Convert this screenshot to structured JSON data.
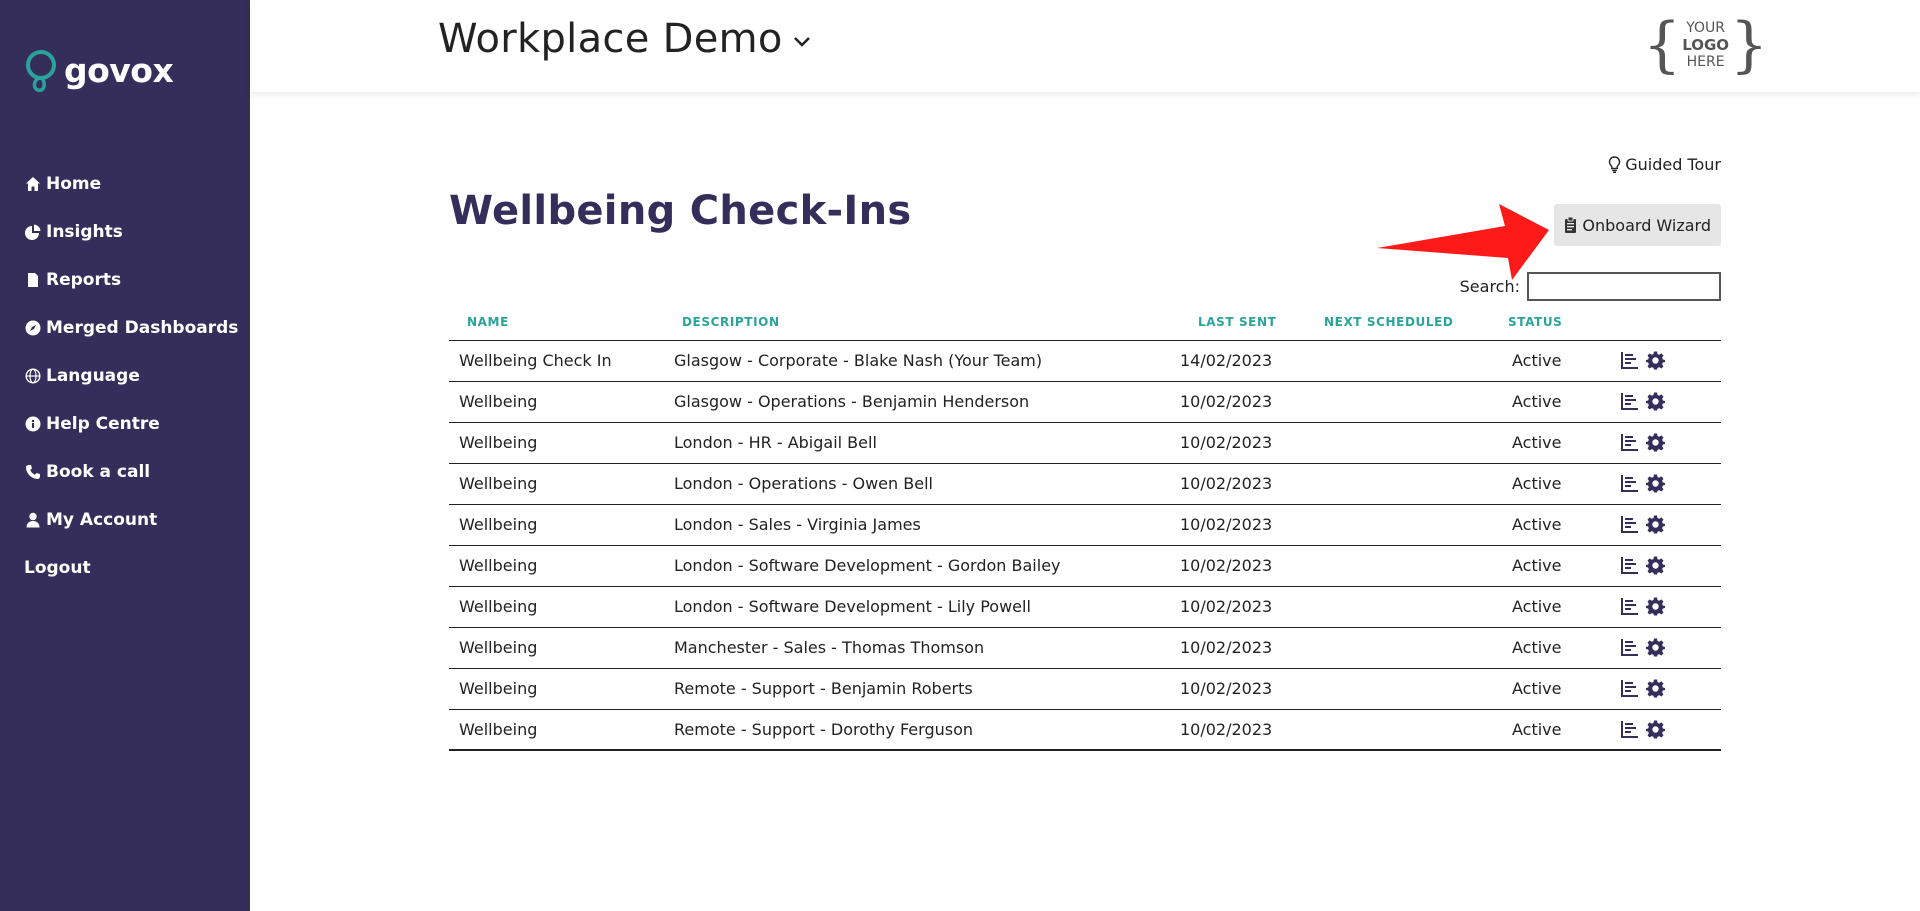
{
  "sidebar": {
    "brand": "govox",
    "items": [
      {
        "label": "Home",
        "icon": "home-icon"
      },
      {
        "label": "Insights",
        "icon": "pie-chart-icon"
      },
      {
        "label": "Reports",
        "icon": "file-icon"
      },
      {
        "label": "Merged Dashboards",
        "icon": "compass-icon"
      },
      {
        "label": "Language",
        "icon": "globe-icon"
      },
      {
        "label": "Help Centre",
        "icon": "info-icon"
      },
      {
        "label": "Book a call",
        "icon": "phone-icon"
      },
      {
        "label": "My Account",
        "icon": "user-icon"
      },
      {
        "label": "Logout",
        "icon": ""
      }
    ]
  },
  "header": {
    "workspace": "Workplace Demo",
    "logo": {
      "line1": "YOUR",
      "line2": "LOGO",
      "line3": "HERE"
    }
  },
  "main": {
    "guided_tour": "Guided Tour",
    "title": "Wellbeing Check-Ins",
    "onboard_label": "Onboard Wizard",
    "search_label": "Search:",
    "search_value": ""
  },
  "table": {
    "columns": {
      "name": "NAME",
      "description": "DESCRIPTION",
      "last_sent": "LAST SENT",
      "next_scheduled": "NEXT SCHEDULED",
      "status": "STATUS"
    },
    "rows": [
      {
        "name": "Wellbeing Check In",
        "description": "Glasgow - Corporate - Blake Nash (Your Team)",
        "last_sent": "14/02/2023",
        "next_scheduled": "",
        "status": "Active"
      },
      {
        "name": "Wellbeing",
        "description": "Glasgow - Operations - Benjamin Henderson",
        "last_sent": "10/02/2023",
        "next_scheduled": "",
        "status": "Active"
      },
      {
        "name": "Wellbeing",
        "description": "London - HR - Abigail Bell",
        "last_sent": "10/02/2023",
        "next_scheduled": "",
        "status": "Active"
      },
      {
        "name": "Wellbeing",
        "description": "London - Operations - Owen Bell",
        "last_sent": "10/02/2023",
        "next_scheduled": "",
        "status": "Active"
      },
      {
        "name": "Wellbeing",
        "description": "London - Sales - Virginia James",
        "last_sent": "10/02/2023",
        "next_scheduled": "",
        "status": "Active"
      },
      {
        "name": "Wellbeing",
        "description": "London - Software Development - Gordon Bailey",
        "last_sent": "10/02/2023",
        "next_scheduled": "",
        "status": "Active"
      },
      {
        "name": "Wellbeing",
        "description": "London - Software Development - Lily Powell",
        "last_sent": "10/02/2023",
        "next_scheduled": "",
        "status": "Active"
      },
      {
        "name": "Wellbeing",
        "description": "Manchester - Sales - Thomas Thomson",
        "last_sent": "10/02/2023",
        "next_scheduled": "",
        "status": "Active"
      },
      {
        "name": "Wellbeing",
        "description": "Remote - Support - Benjamin Roberts",
        "last_sent": "10/02/2023",
        "next_scheduled": "",
        "status": "Active"
      },
      {
        "name": "Wellbeing",
        "description": "Remote - Support - Dorothy Ferguson",
        "last_sent": "10/02/2023",
        "next_scheduled": "",
        "status": "Active"
      }
    ]
  },
  "colors": {
    "sidebar_bg": "#352e5a",
    "brand_accent": "#2aa39b",
    "title": "#352e5a",
    "header_accent": "#2aa39b",
    "arrow": "#ff1a1a",
    "button_bg": "#e6e6e6"
  }
}
